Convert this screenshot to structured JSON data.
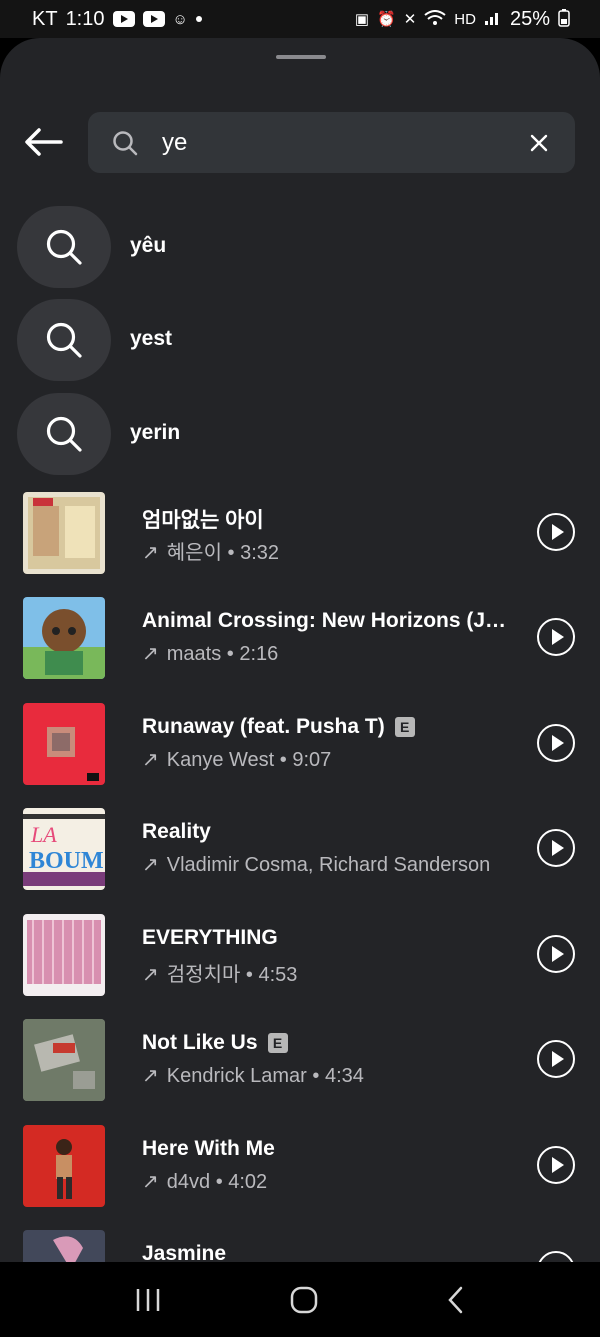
{
  "status_bar": {
    "carrier": "KT",
    "time": "1:10",
    "battery": "25%"
  },
  "search": {
    "query": "ye"
  },
  "suggestions": [
    {
      "text": "yêu"
    },
    {
      "text": "yest"
    },
    {
      "text": "yerin"
    }
  ],
  "songs": [
    {
      "title": "엄마없는 아이",
      "subtitle": "혜은이 • 3:32",
      "explicit": false,
      "art_color": "#e9e2cf"
    },
    {
      "title": "Animal Crossing: New Horizons (Jazz Lounge)",
      "subtitle": "maats • 2:16",
      "explicit": false,
      "art_color": "#5f8c49"
    },
    {
      "title": "Runaway (feat. Pusha T)",
      "subtitle": "Kanye West • 9:07",
      "explicit": true,
      "explicit_label": "E",
      "art_color": "#e82b3d"
    },
    {
      "title": "Reality",
      "subtitle": "Vladimir Cosma, Richard Sanderson",
      "explicit": false,
      "art_color": "#f4efe4"
    },
    {
      "title": "EVERYTHING",
      "subtitle": "검정치마 • 4:53",
      "explicit": false,
      "art_color": "#d99bb5"
    },
    {
      "title": "Not Like Us",
      "subtitle": "Kendrick Lamar • 4:34",
      "explicit": true,
      "explicit_label": "E",
      "art_color": "#7f8a82"
    },
    {
      "title": "Here With Me",
      "subtitle": "d4vd • 4:02",
      "explicit": false,
      "art_color": "#d42a23"
    },
    {
      "title": "Jasmine",
      "subtitle": "",
      "explicit": false,
      "art_color": "#42485a"
    }
  ],
  "icons": {
    "back": "arrow-left-icon",
    "search": "search-icon",
    "clear": "close-icon",
    "play": "play-circle-icon",
    "trend": "trending-up-arrow-icon",
    "nav_recent": "recent-apps-icon",
    "nav_home": "home-icon",
    "nav_back": "back-chevron-icon"
  }
}
